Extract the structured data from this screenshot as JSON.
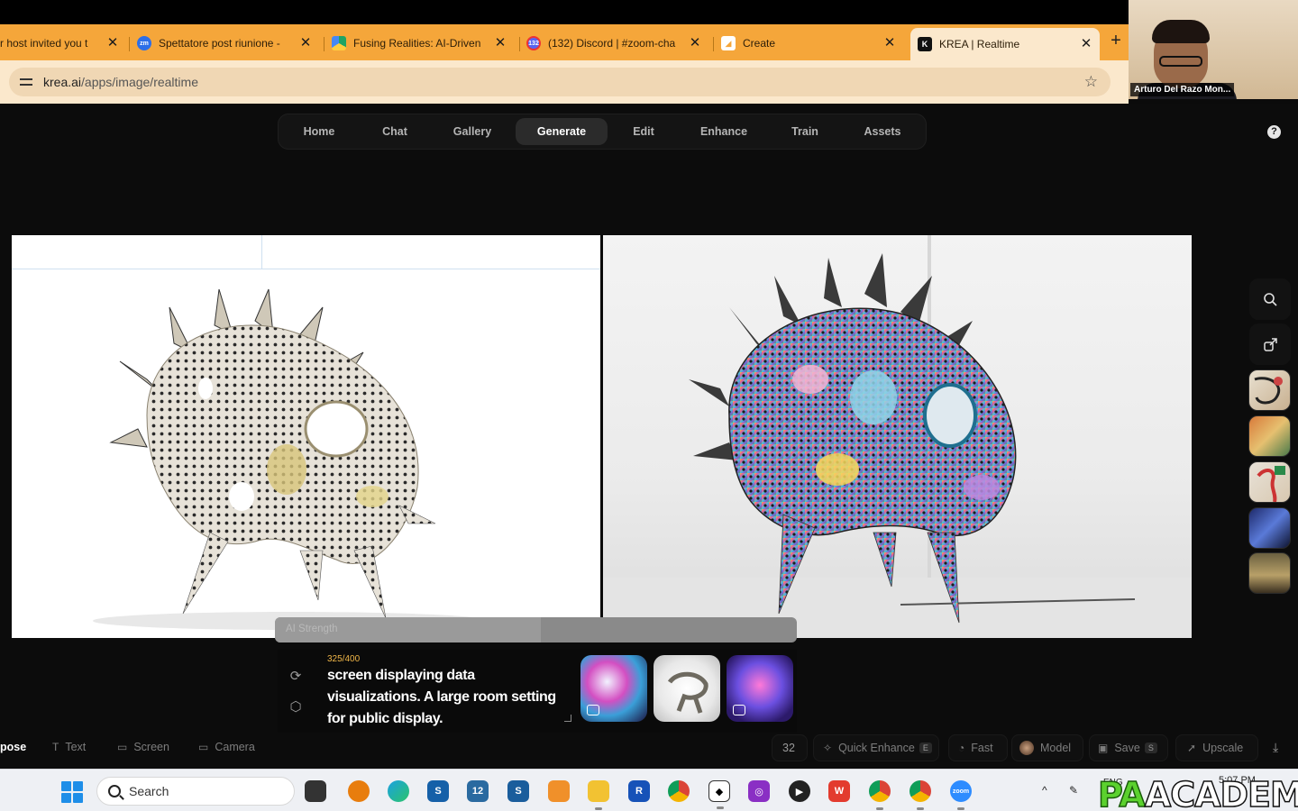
{
  "browser": {
    "tabs": [
      {
        "title": "r host invited you t",
        "favicon": "zoom-icon"
      },
      {
        "title": "Spettatore post riunione -",
        "favicon": "zoom-icon",
        "favicon_text": "zm"
      },
      {
        "title": "Fusing Realities: AI-Driven",
        "favicon": "google-drive-icon"
      },
      {
        "title": "(132) Discord | #zoom-cha",
        "favicon": "discord-icon",
        "favicon_text": "132"
      },
      {
        "title": "Create",
        "favicon": "create-icon"
      },
      {
        "title": "KREA | Realtime",
        "favicon": "krea-icon",
        "active": true
      }
    ],
    "url_host": "krea.ai",
    "url_path": "/apps/image/realtime"
  },
  "video": {
    "name": "Arturo Del Razo Mon..."
  },
  "nav": {
    "items": [
      "Home",
      "Chat",
      "Gallery",
      "Generate",
      "Edit",
      "Enhance",
      "Train",
      "Assets"
    ],
    "active": "Generate"
  },
  "strength": {
    "label": "AI Strength",
    "level": 0.51
  },
  "prompt": {
    "counter": "325/400",
    "text": "screen displaying data visualizations. A large room setting for public display."
  },
  "toolbar": {
    "pose": "pose",
    "text": "Text",
    "screen": "Screen",
    "camera": "Camera",
    "count": "32",
    "quick_enhance": "Quick Enhance",
    "quick_enhance_key": "E",
    "fast": "Fast",
    "model": "Model",
    "save": "Save",
    "save_key": "S",
    "upscale": "Upscale"
  },
  "taskbar": {
    "search": "Search",
    "lang": "ENG",
    "time": "5:07 PM",
    "watermark_a": "PA",
    "watermark_b": "ACADEMY"
  },
  "colors": {
    "tab_bar": "#f5a63a",
    "address_bar": "#fbe8cc",
    "app_bg": "#0c0c0c",
    "counter": "#f0b648"
  }
}
